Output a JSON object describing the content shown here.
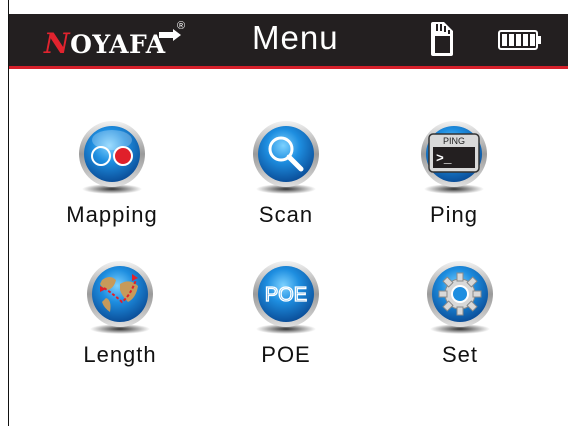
{
  "header": {
    "logo_text": "OYAFA",
    "logo_initial": "N",
    "logo_registered": "®",
    "title": "Menu",
    "sd_icon": "sd-card-icon",
    "battery_icon": "battery-full-icon"
  },
  "colors": {
    "header_bg": "#231f20",
    "accent_red": "#d6202b",
    "icon_blue": "#1a7fd0"
  },
  "menu": {
    "items": [
      {
        "label": "Mapping",
        "icon": "mapping-icon"
      },
      {
        "label": "Scan",
        "icon": "magnifier-icon"
      },
      {
        "label": "Ping",
        "icon": "ping-terminal-icon",
        "icon_text": "PING",
        "icon_prompt": ">_"
      },
      {
        "label": "Length",
        "icon": "globe-icon"
      },
      {
        "label": "POE",
        "icon": "poe-icon",
        "icon_text": "POE"
      },
      {
        "label": "Set",
        "icon": "gear-icon"
      }
    ]
  }
}
